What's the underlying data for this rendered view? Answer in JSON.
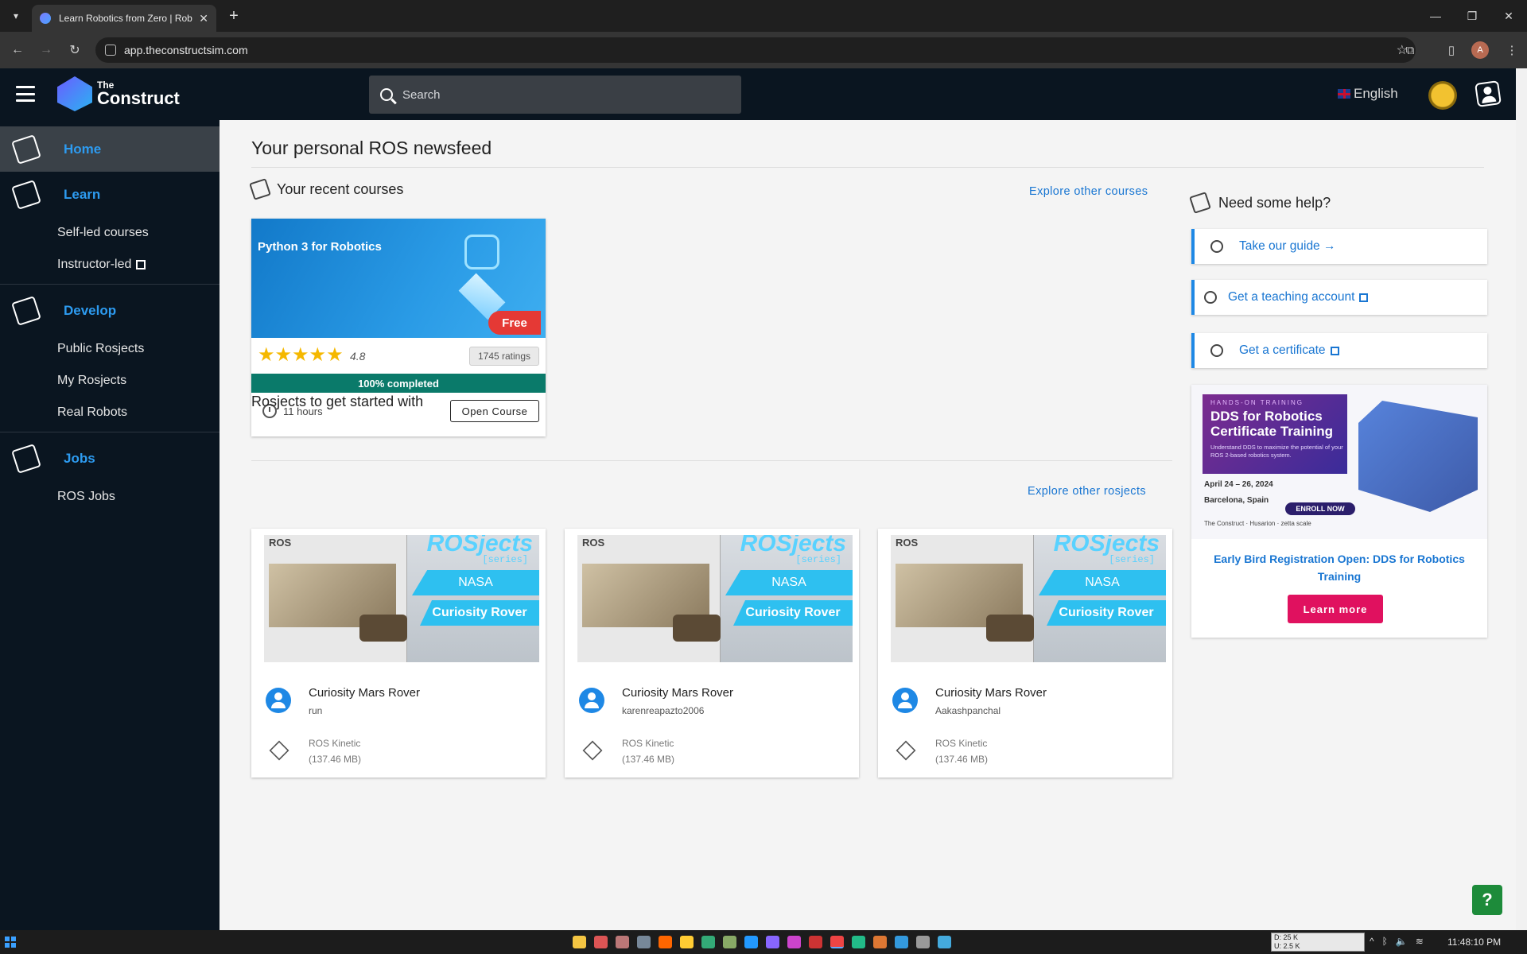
{
  "browser": {
    "tab_title": "Learn Robotics from Zero | Rob",
    "url": "app.theconstructsim.com",
    "new_tab": "+",
    "close_tab": "✕",
    "profile_initial": "A"
  },
  "header": {
    "logo_small": "The",
    "logo_big": "Construct",
    "search_placeholder": "Search",
    "language": "English"
  },
  "sidebar": {
    "sections": [
      {
        "label": "Home",
        "items": []
      },
      {
        "label": "Learn",
        "items": [
          "Self-led courses",
          "Instructor-led"
        ]
      },
      {
        "label": "Develop",
        "items": [
          "Public Rosjects",
          "My Rosjects",
          "Real Robots"
        ]
      },
      {
        "label": "Jobs",
        "items": [
          "ROS Jobs"
        ]
      }
    ]
  },
  "main": {
    "page_title": "Your personal ROS newsfeed",
    "recent_courses": {
      "title": "Your recent courses",
      "explore_link": "Explore other courses",
      "card": {
        "name": "Python 3 for Robotics",
        "badge": "Free",
        "stars": "★★★★★",
        "rating": "4.8",
        "ratings_count": "1745 ratings",
        "progress_text": "100% completed",
        "progress_fraction": 1.0,
        "duration": "11 hours",
        "open_button": "Open Course"
      }
    },
    "rosjects": {
      "title": "Rosjects to get started with",
      "explore_link": "Explore other rosjects",
      "thumb": {
        "brand": "ROS",
        "headline": "ROSjects",
        "series": "[series]",
        "band1": "NASA",
        "band2": "Curiosity Rover"
      },
      "cards": [
        {
          "name": "Curiosity Mars Rover",
          "user": "run",
          "distro": "ROS Kinetic",
          "size": "(137.46 MB)"
        },
        {
          "name": "Curiosity Mars Rover",
          "user": "karenreapazto2006",
          "distro": "ROS Kinetic",
          "size": "(137.46 MB)"
        },
        {
          "name": "Curiosity Mars Rover",
          "user": "Aakashpanchal",
          "distro": "ROS Kinetic",
          "size": "(137.46 MB)"
        }
      ]
    },
    "help": {
      "title": "Need some help?",
      "items": [
        "Take our guide →",
        "Get a teaching account",
        "Get a certificate"
      ]
    },
    "promo": {
      "kicker": "HANDS-ON TRAINING",
      "headline": "DDS for Robotics Certificate Training",
      "subtext": "Understand DDS to maximize the potential of your ROS 2-based robotics system.",
      "date": "April 24 – 26, 2024",
      "location": "Barcelona, Spain",
      "enroll": "ENROLL NOW",
      "logos": "The Construct · Husarion · zetta scale",
      "caption": "Early Bird Registration Open: DDS for Robotics Training",
      "button": "Learn more"
    },
    "fab": "?"
  },
  "taskbar": {
    "tray_d": "D: 25 K",
    "tray_u": "U: 2.5 K",
    "time": "11:48:10 PM"
  }
}
